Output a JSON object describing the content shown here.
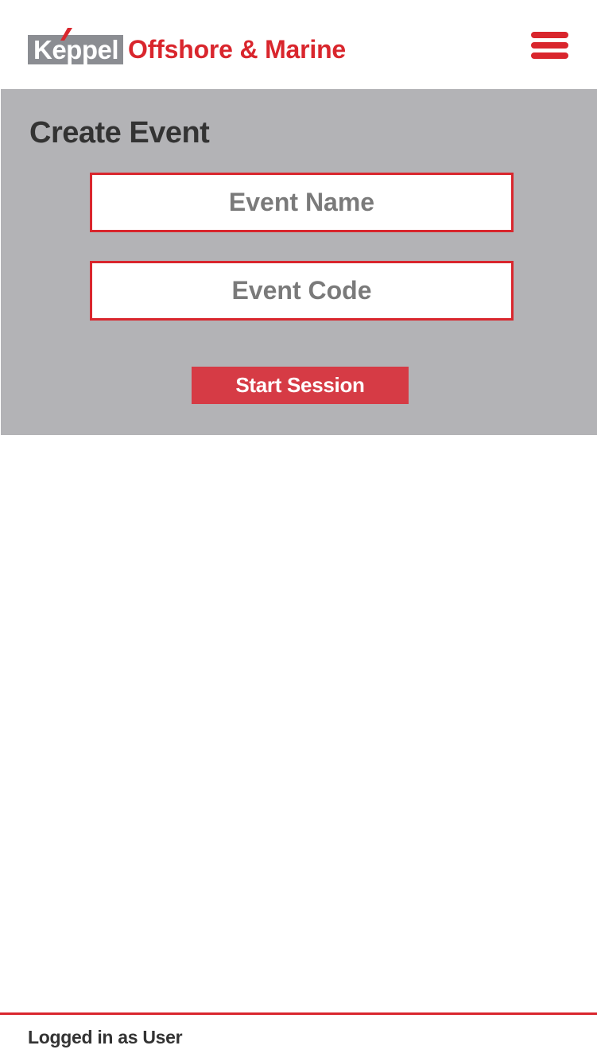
{
  "header": {
    "brand": "Keppel",
    "tagline": "Offshore & Marine",
    "menu_icon": "hamburger-menu-icon"
  },
  "form": {
    "title": "Create Event",
    "event_name": {
      "placeholder": "Event Name",
      "value": ""
    },
    "event_code": {
      "placeholder": "Event Code",
      "value": ""
    },
    "submit_label": "Start Session"
  },
  "footer": {
    "status": "Logged in as User"
  },
  "colors": {
    "accent": "#d9262d",
    "brand_grey": "#8b8d92",
    "panel": "#b3b3b6",
    "button": "#d63b45",
    "text_dark": "#333333"
  }
}
